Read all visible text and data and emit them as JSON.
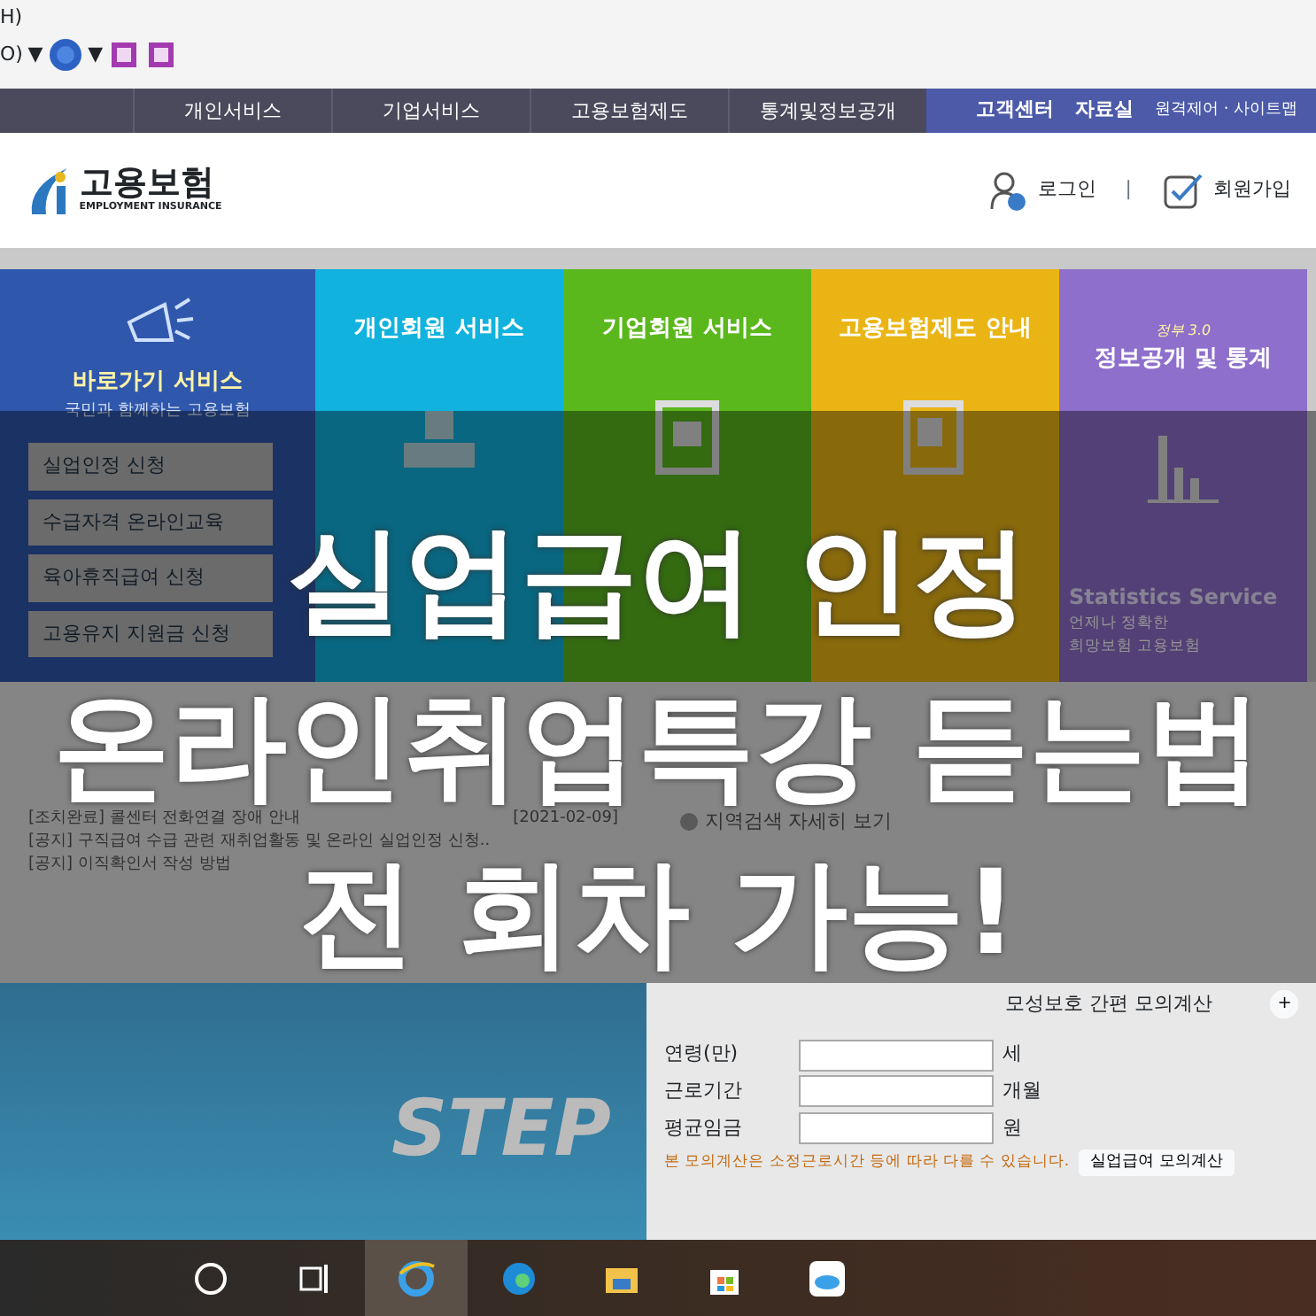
{
  "browser_toolbar": {
    "menu_fragment": "H)",
    "dropdown_fragment": "O)",
    "dropdown_arrow": "▼",
    "help_arrow": "▼"
  },
  "top_nav": {
    "items": [
      "개인서비스",
      "기업서비스",
      "고용보험제도",
      "통계및정보공개"
    ],
    "utility": [
      "고객센터",
      "자료실"
    ],
    "links": "원격제어 · 사이트맵"
  },
  "header": {
    "logo_title": "고용보험",
    "logo_subtitle": "EMPLOYMENT INSURANCE",
    "login": "로그인",
    "separator": "|",
    "signup": "회원가입"
  },
  "quick": {
    "title": "바로가기 서비스",
    "subtitle": "국민과 함께하는 고용보험",
    "buttons": [
      "실업인정 신청",
      "수급자격 온라인교육",
      "육아휴직급여 신청",
      "고용유지 지원금 신청"
    ]
  },
  "tiles": [
    {
      "kind": "person",
      "title": "개인회원 서비스",
      "color": "#11b2de"
    },
    {
      "kind": "building",
      "title": "기업회원 서비스",
      "color": "#5bb81c"
    },
    {
      "kind": "document",
      "title": "고용보험제도 안내",
      "color": "#eab514"
    },
    {
      "kind": "chart",
      "title": "정보공개 및 통계",
      "badge": "정부 3.0",
      "color": "#8e6fcb",
      "english": "Statistics Service",
      "desc": "언제나 정확한",
      "caption": "희망보험 고용보험"
    }
  ],
  "notices": [
    {
      "text": "[조치완료] 콜센터 전화연결 장애 안내",
      "date": "[2021-02-09]"
    },
    {
      "text": "[공지] 구직급여 수급 관련 재취업활동 및 온라인 실업인정 신청.."
    },
    {
      "text": "[공지] 이직확인서 작성 방법"
    }
  ],
  "center_search": {
    "region_link": "지역검색 자세히 보기"
  },
  "banner": {
    "heading": "STEP"
  },
  "calculator": {
    "title": "모성보호 간편 모의계산",
    "plus": "+",
    "fields": [
      {
        "label": "연령(만)",
        "unit": "세"
      },
      {
        "label": "근로기간",
        "unit": "개월"
      },
      {
        "label": "평균임금",
        "unit": "원"
      }
    ],
    "note": "본 모의계산은 소정근로시간 등에 따라 다를 수 있습니다.",
    "button": "실업급여 모의계산"
  },
  "overlay": {
    "lines": [
      "실업급여 인정",
      "온라인취업특강 듣는법",
      "전 회차 가능!"
    ]
  },
  "taskbar": {
    "items": [
      {
        "kind": "search",
        "selected": false
      },
      {
        "kind": "taskview",
        "selected": false
      },
      {
        "kind": "ie",
        "selected": true
      },
      {
        "kind": "edge",
        "selected": false
      },
      {
        "kind": "folder",
        "selected": false
      },
      {
        "kind": "store",
        "selected": false
      },
      {
        "kind": "cloud",
        "selected": false
      }
    ]
  }
}
